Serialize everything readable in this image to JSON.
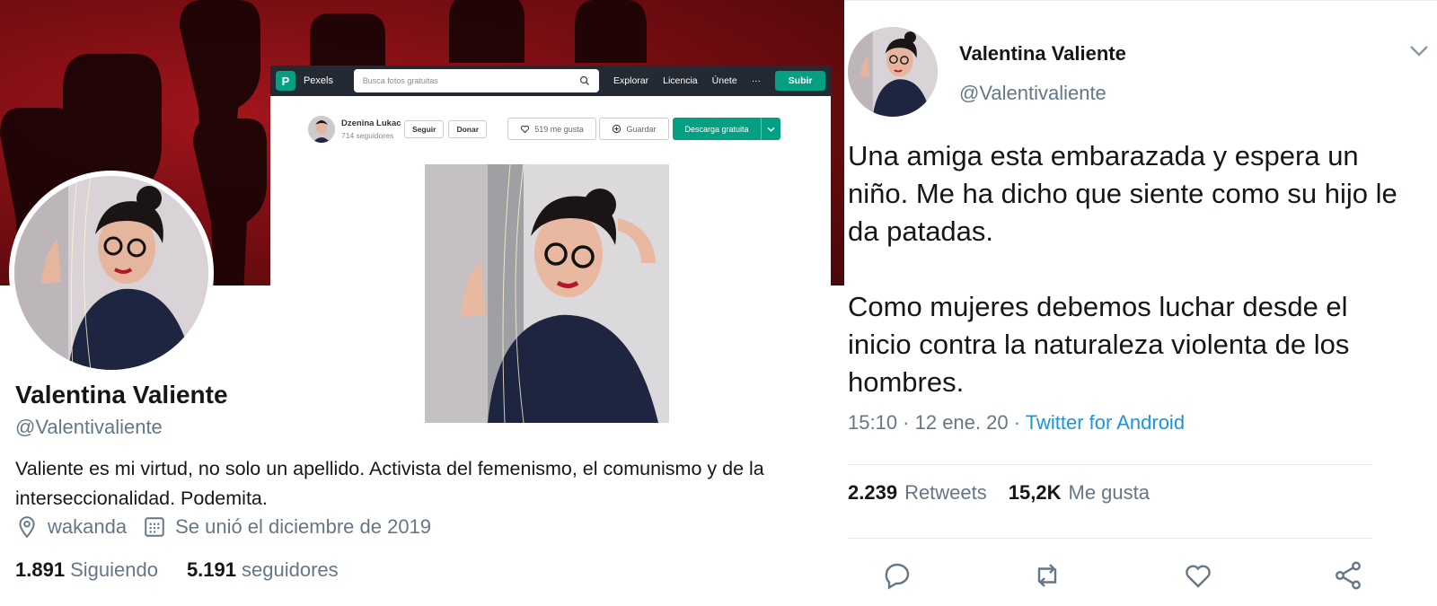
{
  "profile": {
    "name": "Valentina Valiente",
    "handle": "@Valentivaliente",
    "bio": "Valiente es mi virtud, no solo un apellido. Activista del femenismo, el comunismo y de la interseccionalidad. Podemita.",
    "location": "wakanda",
    "location_icon": "location-pin-icon",
    "joined": "Se unió el diciembre de 2019",
    "joined_icon": "calendar-icon",
    "following_count": "1.891",
    "following_label": "Siguiendo",
    "followers_count": "5.191",
    "followers_label": "seguidores",
    "banner_color": "#8f1218"
  },
  "pexels": {
    "brand": "Pexels",
    "logo_letter": "P",
    "search_placeholder": "Busca fotos gratuitas",
    "nav": [
      "Explorar",
      "Licencia",
      "Únete",
      "···"
    ],
    "upload_label": "Subir",
    "author_name": "Dzenina Lukac",
    "author_followers": "714 seguidores",
    "follow_label": "Seguir",
    "donate_label": "Donar",
    "likes_label": "519 me gusta",
    "save_label": "Guardar",
    "download_label": "Descarga gratuita",
    "accent_color": "#05a081"
  },
  "tweet": {
    "name": "Valentina Valiente",
    "handle": "@Valentivaliente",
    "text": "Una amiga esta embarazada y espera un niño. Me ha dicho que siente como su hijo le da patadas.\n\nComo mujeres debemos luchar desde el inicio contra la naturaleza violenta de los hombres.",
    "time": "15:10 · 12 ene. 20 · ",
    "source": "Twitter for Android",
    "retweets_count": "2.239",
    "retweets_label": "Retweets",
    "likes_count": "15,2K",
    "likes_label": "Me gusta",
    "actions": [
      "reply-icon",
      "retweet-icon",
      "like-icon",
      "share-icon"
    ],
    "link_color": "#1b95e0"
  }
}
